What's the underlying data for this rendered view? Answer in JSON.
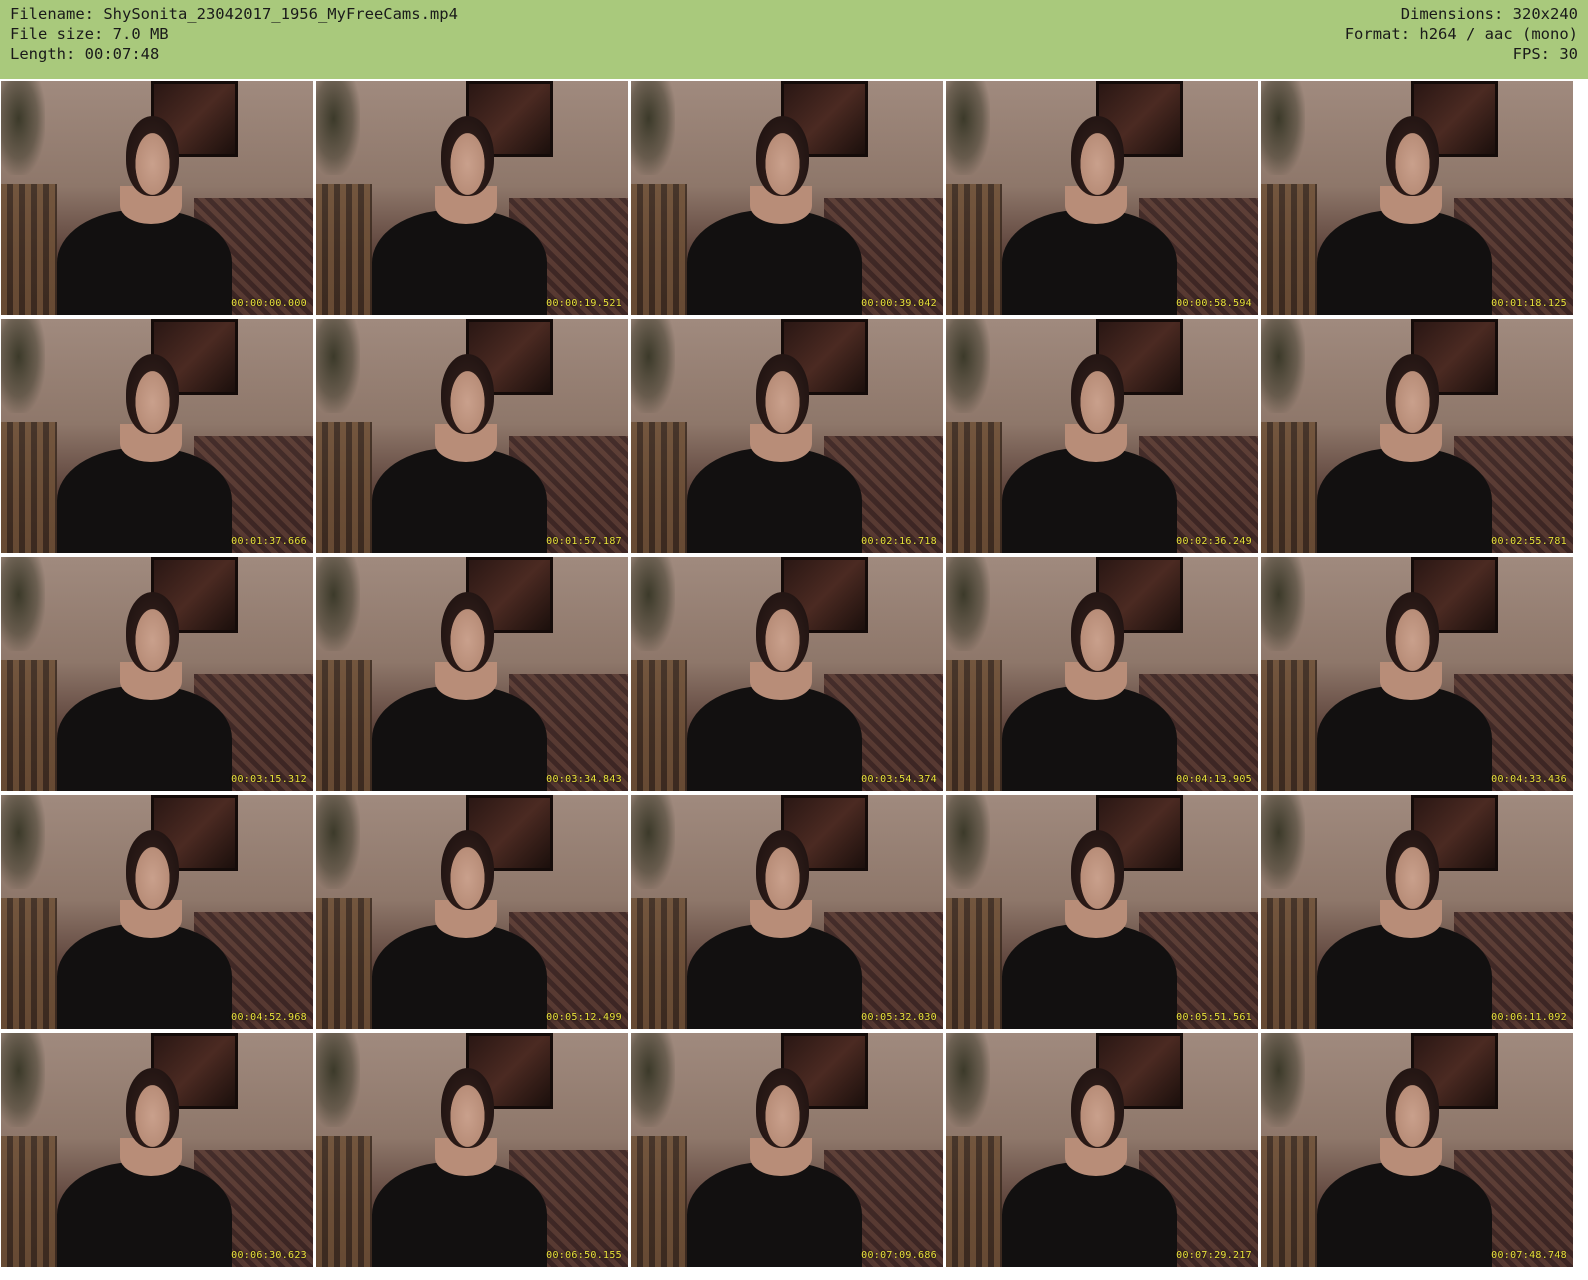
{
  "header": {
    "filename": "Filename: ShySonita_23042017_1956_MyFreeCams.mp4",
    "filesize": "File size: 7.0 MB",
    "length": "Length: 00:07:48",
    "dimensions": "Dimensions: 320x240",
    "format": "Format: h264 / aac (mono)",
    "fps": "FPS: 30"
  },
  "thumbnails": [
    {
      "timestamp": "00:00:00.000"
    },
    {
      "timestamp": "00:00:19.521"
    },
    {
      "timestamp": "00:00:39.042"
    },
    {
      "timestamp": "00:00:58.594"
    },
    {
      "timestamp": "00:01:18.125"
    },
    {
      "timestamp": "00:01:37.666"
    },
    {
      "timestamp": "00:01:57.187"
    },
    {
      "timestamp": "00:02:16.718"
    },
    {
      "timestamp": "00:02:36.249"
    },
    {
      "timestamp": "00:02:55.781"
    },
    {
      "timestamp": "00:03:15.312"
    },
    {
      "timestamp": "00:03:34.843"
    },
    {
      "timestamp": "00:03:54.374"
    },
    {
      "timestamp": "00:04:13.905"
    },
    {
      "timestamp": "00:04:33.436"
    },
    {
      "timestamp": "00:04:52.968"
    },
    {
      "timestamp": "00:05:12.499"
    },
    {
      "timestamp": "00:05:32.030"
    },
    {
      "timestamp": "00:05:51.561"
    },
    {
      "timestamp": "00:06:11.092"
    },
    {
      "timestamp": "00:06:30.623"
    },
    {
      "timestamp": "00:06:50.155"
    },
    {
      "timestamp": "00:07:09.686"
    },
    {
      "timestamp": "00:07:29.217"
    },
    {
      "timestamp": "00:07:48.748"
    }
  ]
}
